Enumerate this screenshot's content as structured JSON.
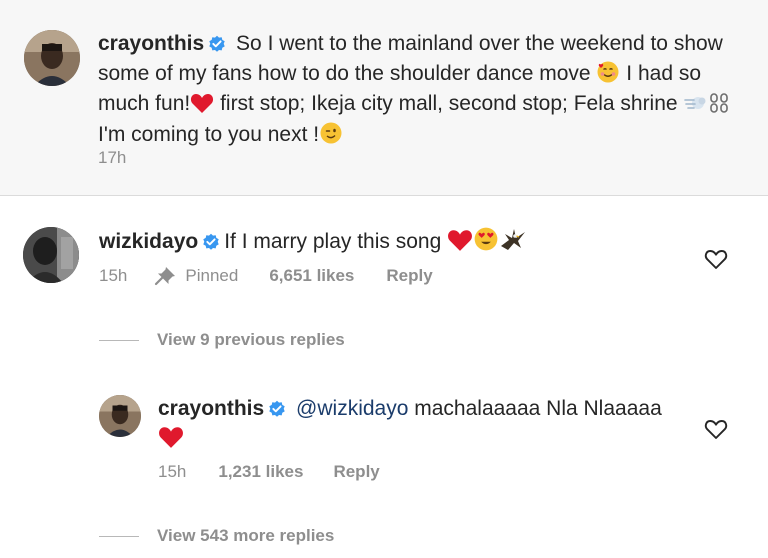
{
  "post_caption": {
    "username": "crayonthis",
    "text_part1": "So I went to the mainland over the weekend to show some of my fans how to do the shoulder dance move",
    "text_part2": "I had so much fun!",
    "text_part3": "first stop; Ikeja city mall, second stop; Fela shrine",
    "text_part4": "I'm coming to you next !",
    "timestamp": "17h"
  },
  "comment": {
    "username": "wizkidayo",
    "text": "If I marry play this song",
    "timestamp": "15h",
    "pinned_label": "Pinned",
    "likes": "6,651 likes",
    "reply_label": "Reply",
    "view_previous": "View 9 previous replies"
  },
  "reply": {
    "username": "crayonthis",
    "mention": "@wizkidayo",
    "text": "machalaaaaa Nla Nlaaaaa",
    "timestamp": "15h",
    "likes": "1,231 likes",
    "reply_label": "Reply",
    "view_more": "View 543 more replies"
  },
  "icons": {
    "verified": "verified-badge-icon",
    "heart": "heart-outline-icon",
    "pin": "pin-icon"
  },
  "colors": {
    "verified_blue": "#3897f0",
    "muted_text": "#8e8e8e",
    "primary_text": "#262626",
    "mention_text": "#1b3c6b",
    "emoji_red_heart": "#e0192d"
  }
}
